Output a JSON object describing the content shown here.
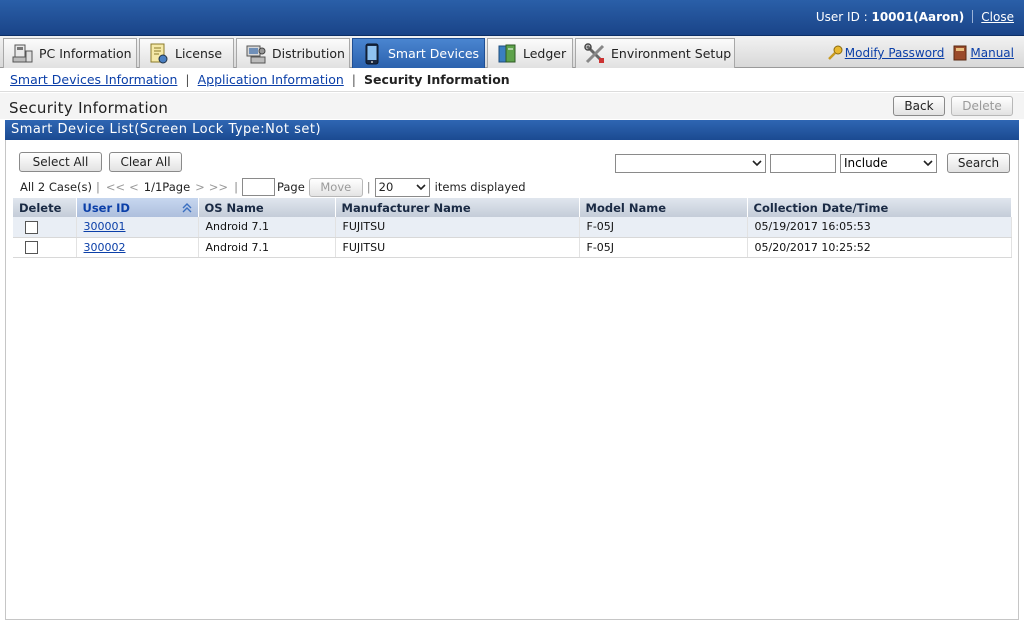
{
  "header": {
    "user_label": "User ID : ",
    "user_value": "10001(Aaron)",
    "close_label": "Close"
  },
  "tabs": [
    {
      "label": "PC Information",
      "icon": "pc-icon"
    },
    {
      "label": "License",
      "icon": "license-icon"
    },
    {
      "label": "Distribution",
      "icon": "distribution-icon"
    },
    {
      "label": "Smart Devices",
      "icon": "smartphone-icon",
      "active": true
    },
    {
      "label": "Ledger",
      "icon": "ledger-icon"
    },
    {
      "label": "Environment Setup",
      "icon": "tools-icon"
    }
  ],
  "tab_links": {
    "modify_password": "Modify Password",
    "manual": "Manual"
  },
  "subnav": {
    "link1": "Smart Devices Information",
    "link2": "Application Information",
    "current": "Security Information"
  },
  "page": {
    "title": "Security Information",
    "back_label": "Back",
    "delete_label": "Delete"
  },
  "section": {
    "title": "Smart Device List(Screen Lock Type:Not set)"
  },
  "toolbar": {
    "select_all": "Select All",
    "clear_all": "Clear All",
    "filter_field_value": "",
    "filter_text_value": "",
    "match_mode": "Include",
    "search_label": "Search"
  },
  "pager": {
    "count": "All 2 Case(s)",
    "first": "<<",
    "prev": "<",
    "page_info": "1/1Page",
    "next": ">",
    "last": ">>",
    "page_input_value": "",
    "page_label": "Page",
    "move_label": "Move",
    "per_page": "20",
    "items_label": "items displayed"
  },
  "table": {
    "columns": [
      "Delete",
      "User ID",
      "OS Name",
      "Manufacturer Name",
      "Model Name",
      "Collection Date/Time"
    ],
    "rows": [
      {
        "user_id": "300001",
        "os": "Android 7.1",
        "manufacturer": "FUJITSU",
        "model": "F-05J",
        "collected": "05/19/2017 16:05:53"
      },
      {
        "user_id": "300002",
        "os": "Android 7.1",
        "manufacturer": "FUJITSU",
        "model": "F-05J",
        "collected": "05/20/2017 10:25:52"
      }
    ]
  }
}
